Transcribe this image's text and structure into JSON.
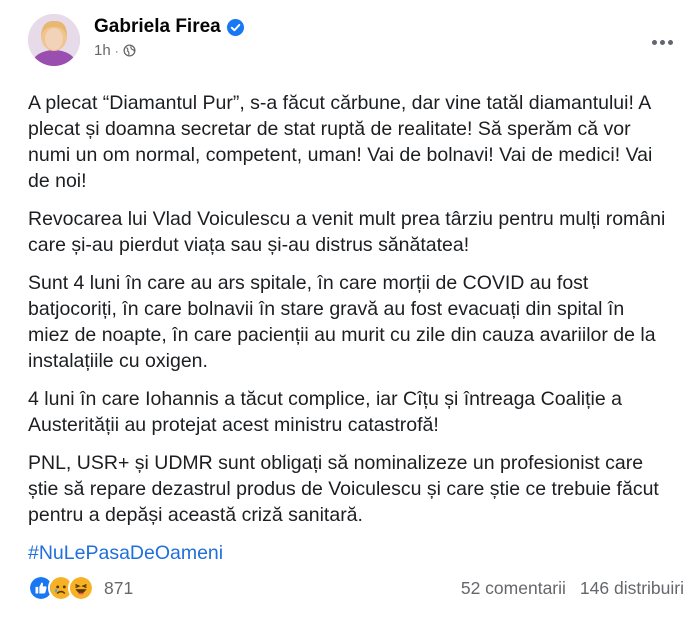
{
  "author": {
    "name": "Gabriela Firea",
    "time": "1h",
    "separator": "·",
    "verified_color": "#1877f2"
  },
  "post": {
    "paragraphs": [
      "A plecat “Diamantul Pur”, s-a făcut cărbune, dar vine tatăl diamantului! A plecat și doamna secretar de stat ruptă de realitate! Să sperăm că vor numi un om normal, competent, uman! Vai de bolnavi! Vai de medici! Vai de noi!",
      "Revocarea lui Vlad Voiculescu a venit mult prea târziu pentru mulți români care și-au pierdut viața sau și-au distrus sănătatea!",
      "Sunt 4 luni în care au ars spitale, în care morții de COVID au fost batjocoriți, în care bolnavii în stare gravă au fost evacuați din spital în miez de noapte, în care pacienții au murit cu zile din cauza avariilor de la instalațiile cu oxigen.",
      "4 luni în care Iohannis a tăcut complice, iar Cîțu și întreaga Coaliție a Austerității au protejat acest ministru catastrofă!",
      "PNL, USR+ și UDMR sunt obligați să nominalizeze un profesionist care știe să repare dezastrul produs de Voiculescu și care știe ce trebuie făcut pentru a depăși această criză sanitară."
    ],
    "hashtag": "#NuLePasaDeOameni"
  },
  "footer": {
    "reaction_icons": [
      "like-icon",
      "sad-icon",
      "haha-icon"
    ],
    "reaction_count": "871",
    "comments": "52 comentarii",
    "shares": "146 distribuiri"
  },
  "colors": {
    "hashtag": "#216fdb",
    "secondary_text": "#65676b",
    "like_blue": "#1877f2",
    "emoji_yellow": "#f7b125"
  }
}
